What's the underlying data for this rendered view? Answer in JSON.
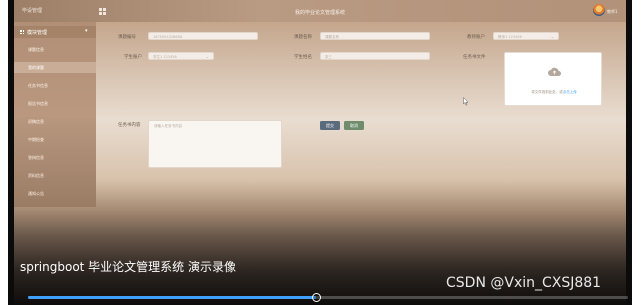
{
  "topbar": {
    "brand": "毕设管理",
    "title": "我的毕业论文管理系统",
    "user": "教师1"
  },
  "sidebar": {
    "section_label": "模块管理",
    "section_caret": "▾",
    "items": [
      {
        "label": "课题信息",
        "active": false
      },
      {
        "label": "我的课题",
        "active": true
      },
      {
        "label": "任务书信息",
        "active": false
      },
      {
        "label": "报告书信息",
        "active": false
      },
      {
        "label": "初稿信息",
        "active": false
      },
      {
        "label": "中期检查",
        "active": false
      },
      {
        "label": "答辩信息",
        "active": false
      },
      {
        "label": "资料信息",
        "active": false
      },
      {
        "label": "通知公告",
        "active": false
      }
    ]
  },
  "form": {
    "topic_no": {
      "label": "课题编号",
      "value": "1675091026688"
    },
    "topic_name": {
      "label": "课题名称",
      "placeholder": "课题名称"
    },
    "teacher_account": {
      "label": "教师账户",
      "value": "教师1 123456"
    },
    "student_account": {
      "label": "学生账户",
      "value": "学生1 123456"
    },
    "student_name": {
      "label": "学生姓名",
      "placeholder": "张三"
    },
    "task_file": {
      "label": "任务书文件",
      "upload_hint_prefix": "将文件拖到此处，或",
      "upload_hint_link": "点击上传"
    },
    "task_content": {
      "label": "任务书内容",
      "placeholder": "请输入任务书内容"
    },
    "submit_label": "提交",
    "cancel_label": "取消"
  },
  "caption": "springboot 毕业论文管理系统 演示录像",
  "watermark": "CSDN @Vxin_CXSJ881",
  "progress": {
    "value": 0.48
  },
  "colors": {
    "accent": "#3fa0ff",
    "submit": "#5a6b7c",
    "cancel": "#6f8d6c"
  }
}
